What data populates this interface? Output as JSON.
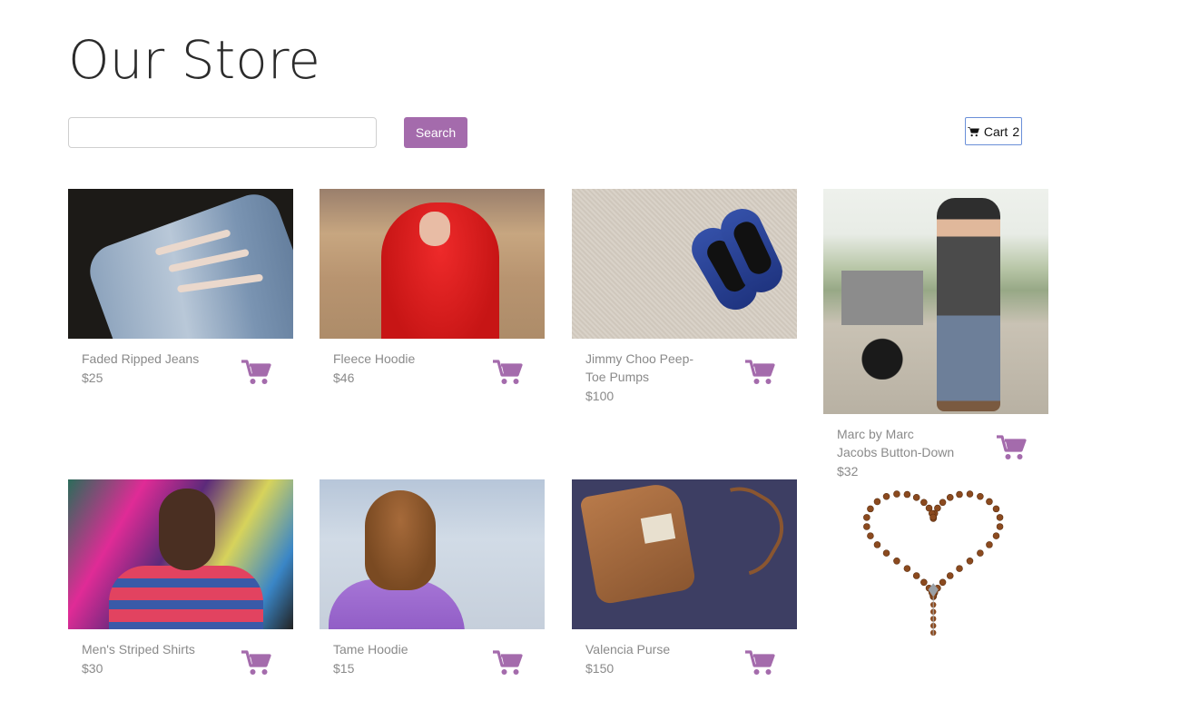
{
  "header": {
    "title": "Our Store"
  },
  "toolbar": {
    "search_value": "",
    "search_placeholder": "",
    "search_label": "Search",
    "cart_label": "Cart",
    "cart_count": "2"
  },
  "products": [
    {
      "name": "Faded Ripped Jeans",
      "price": "$25",
      "image": "ripped-jeans-photo"
    },
    {
      "name": "Fleece Hoodie",
      "price": "$46",
      "image": "red-hoodie-photo"
    },
    {
      "name": "Jimmy Choo Peep-Toe Pumps",
      "price": "$100",
      "image": "blue-pumps-photo"
    },
    {
      "name": "Marc by Marc Jacobs Button-Down",
      "price": "$32",
      "image": "man-with-motorcycle-photo"
    },
    {
      "name": "Men's Striped Shirts",
      "price": "$30",
      "image": "striped-shirt-man-photo"
    },
    {
      "name": "Tame Hoodie",
      "price": "$15",
      "image": "purple-hoodie-girl-photo"
    },
    {
      "name": "Valencia Purse",
      "price": "$150",
      "image": "leather-purse-photo"
    },
    {
      "name": "",
      "price": "",
      "image": "rosary-photo"
    }
  ],
  "icons": {
    "cart": "shopping-cart-icon",
    "add_to_cart": "add-to-cart-icon"
  },
  "colors": {
    "accent": "#a46bac",
    "muted_text": "#8a8a8a",
    "cart_border": "#6a8fd8"
  }
}
